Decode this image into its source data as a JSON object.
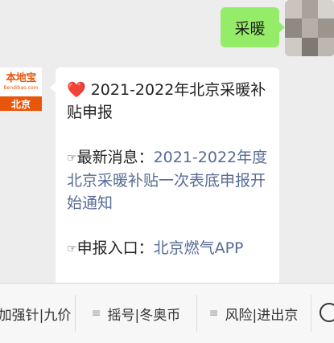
{
  "user_message": {
    "text": "采暖"
  },
  "bot": {
    "avatar_name": "本地宝",
    "avatar_subtitle": "Bendibao.com",
    "avatar_city": "北京"
  },
  "bot_message": {
    "heart_icon": "❤️",
    "title": "2021-2022年北京采暖补贴申报",
    "pointer_icon": "☞",
    "news_label": "最新消息：",
    "news_link": "2021-2022年度北京采暖补贴一次表底申报开始通知",
    "entry_label": "申报入口：",
    "entry_link": "北京燃气APP"
  },
  "menu": {
    "items": [
      {
        "label": "加强针|九价"
      },
      {
        "label": "摇号|冬奥币"
      },
      {
        "label": "风险|进出京"
      }
    ],
    "menu_icon": "≡"
  },
  "colors": {
    "user_bubble": "#95ec69",
    "link": "#576b95",
    "brand_orange": "#e8560c",
    "background": "#ededed"
  }
}
